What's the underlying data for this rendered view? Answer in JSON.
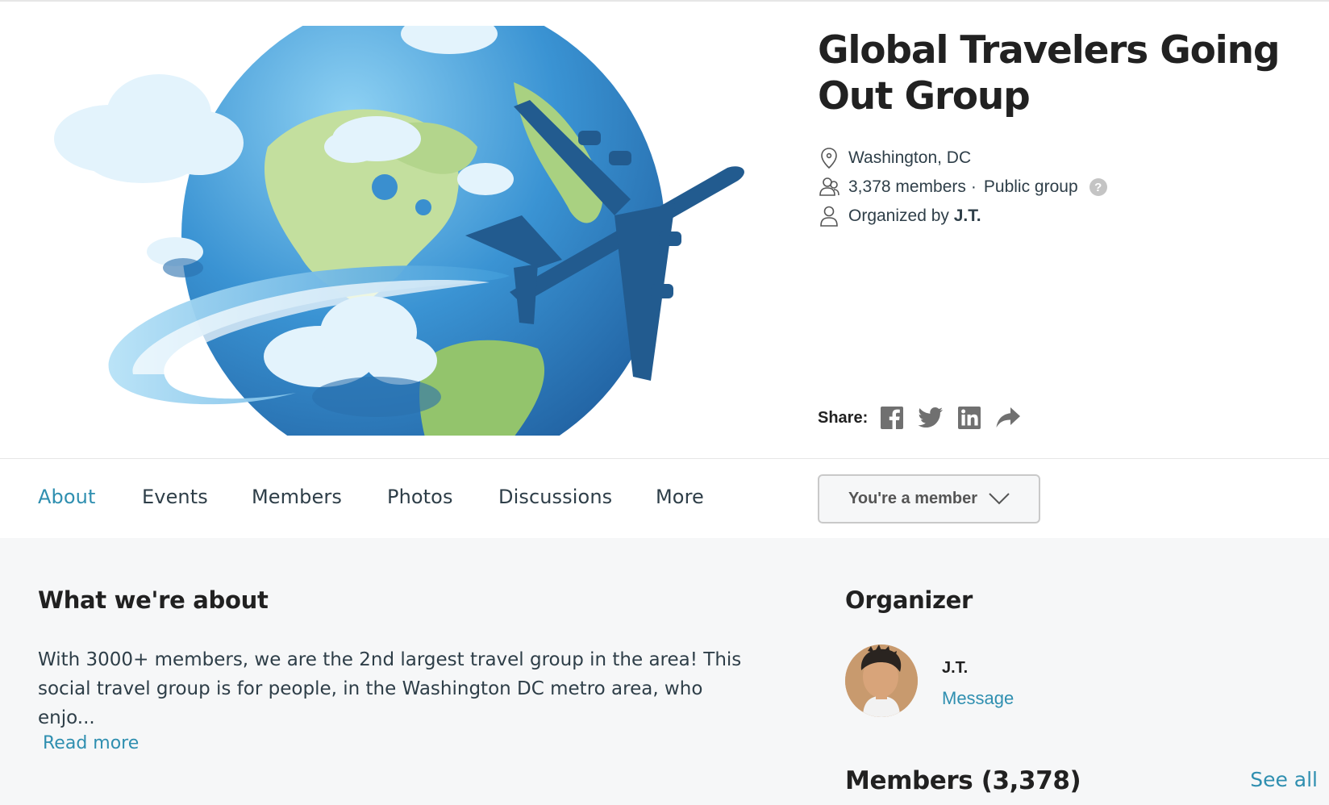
{
  "group": {
    "title": "Global Travelers Going Out Group",
    "location": "Washington, DC",
    "members_count": "3,378 members",
    "separator": "·",
    "privacy": "Public group",
    "help": "?",
    "organized_by_prefix": "Organized by",
    "organizer_name": "J.T."
  },
  "share": {
    "label": "Share:",
    "icons": [
      "facebook-icon",
      "twitter-icon",
      "linkedin-icon",
      "share-arrow-icon"
    ]
  },
  "tabs": [
    {
      "label": "About",
      "active": true
    },
    {
      "label": "Events",
      "active": false
    },
    {
      "label": "Members",
      "active": false
    },
    {
      "label": "Photos",
      "active": false
    },
    {
      "label": "Discussions",
      "active": false
    },
    {
      "label": "More",
      "active": false
    }
  ],
  "membership": {
    "button_label": "You're a member"
  },
  "about": {
    "title": "What we're about",
    "text": "With 3000+ members, we are the 2nd largest travel group in the area! This\nsocial travel group is for people, in the Washington DC metro area, who enjo...",
    "read_more": "Read more"
  },
  "organizer": {
    "title": "Organizer",
    "name": "J.T.",
    "message_link": "Message"
  },
  "members": {
    "title": "Members (3,378)",
    "see_all": "See all"
  },
  "colors": {
    "accent": "#2f8fb0",
    "heading": "#212121",
    "text": "#2e3e48",
    "icon_gray": "#707070",
    "background": "#f6f7f8",
    "plane": "#225b8f"
  }
}
